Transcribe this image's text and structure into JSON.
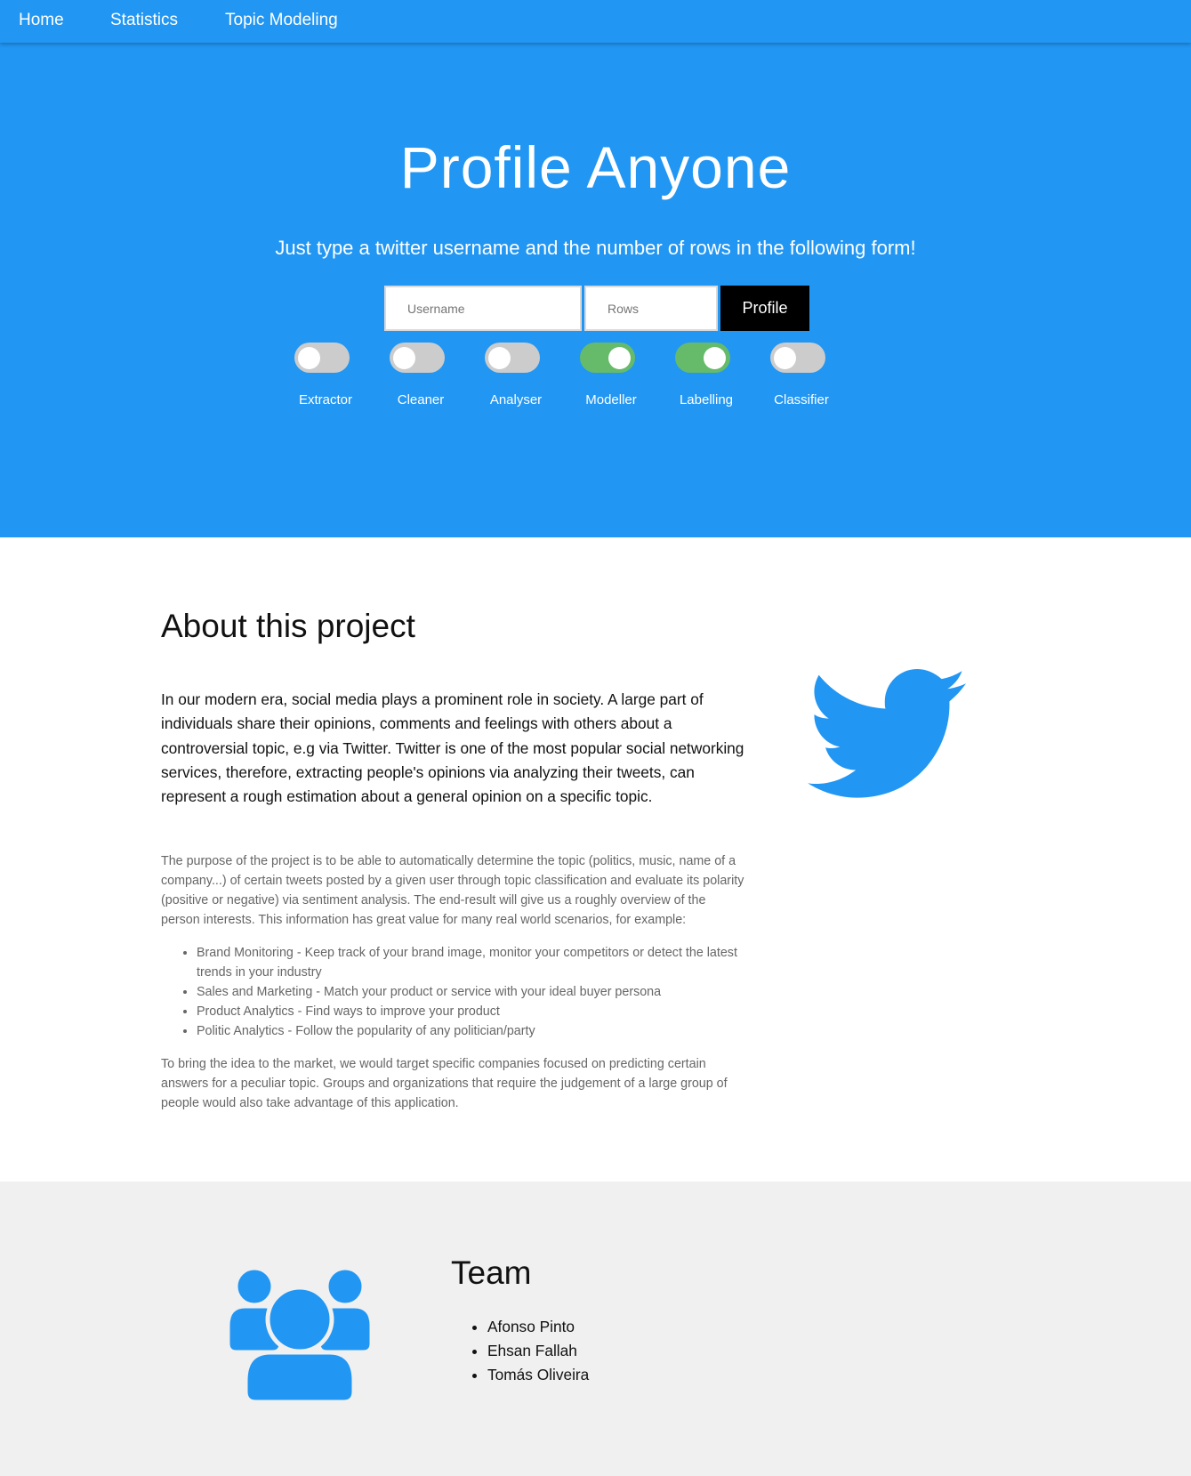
{
  "nav": {
    "items": [
      "Home",
      "Statistics",
      "Topic Modeling"
    ]
  },
  "hero": {
    "title": "Profile Anyone",
    "subtitle": "Just type a twitter username and the number of rows in the following form!",
    "username_placeholder": "Username",
    "rows_placeholder": "Rows",
    "profile_button": "Profile",
    "toggles": [
      {
        "label": "Extractor",
        "on": false
      },
      {
        "label": "Cleaner",
        "on": false
      },
      {
        "label": "Analyser",
        "on": false
      },
      {
        "label": "Modeller",
        "on": true
      },
      {
        "label": "Labelling",
        "on": true
      },
      {
        "label": "Classifier",
        "on": false
      }
    ]
  },
  "about": {
    "title": "About this project",
    "lead": "In our modern era, social media plays a prominent role in society. A large part of individuals share their opinions, comments and feelings with others about a controversial topic, e.g via Twitter. Twitter is one of the most popular social networking services, therefore, extracting people's opinions via analyzing their tweets, can represent a rough estimation about a general opinion on a specific topic.",
    "purpose": "The purpose of the project is to be able to automatically determine the topic (politics, music, name of a company...) of certain tweets posted by a given user through topic classification and evaluate its polarity (positive or negative) via sentiment analysis. The end-result will give us a roughly overview of the person interests. This information has great value for many real world scenarios, for example:",
    "examples": [
      "Brand Monitoring - Keep track of your brand image, monitor your competitors or detect the latest trends in your industry",
      "Sales and Marketing - Match your product or service with your ideal buyer persona",
      "Product Analytics - Find ways to improve your product",
      "Politic Analytics - Follow the popularity of any politician/party"
    ],
    "market": "To bring the idea to the market, we would target specific companies focused on predicting certain answers for a peculiar topic. Groups and organizations that require the judgement of a large group of people would also take advantage of this application.",
    "icon": "twitter-bird-icon"
  },
  "team": {
    "title": "Team",
    "members": [
      "Afonso Pinto",
      "Ehsan Fallah",
      "Tomás Oliveira"
    ],
    "icon": "users-group-icon"
  },
  "colors": {
    "brand_blue": "#2196f3",
    "toggle_on": "#66bb6a",
    "toggle_off": "#cccccc",
    "team_bg": "#f0f0f0"
  }
}
